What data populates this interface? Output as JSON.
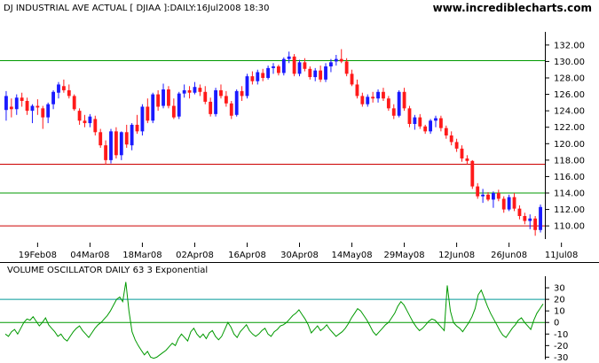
{
  "header": {
    "title": "DJ INDUSTRIAL AVE ACTUAL [ DJIAA ]:DAILY:16Jul2008 18:30",
    "site": "www.incrediblecharts.com"
  },
  "colors": {
    "up_candle": "#1a1aff",
    "down_candle": "#ff1a1a",
    "support_line": "#cc0000",
    "resistance_line": "#009900",
    "oscillator_line": "#009900",
    "oscillator_zero": "#009900",
    "oscillator_band": "#009999"
  },
  "chart_data": [
    {
      "type": "candlestick",
      "title": "DJ INDUSTRIAL AVE ACTUAL [ DJIAA ]:DAILY:16Jul2008 18:30",
      "ylim": [
        108.4,
        133.6
      ],
      "yticks": [
        "132.00",
        "130.00",
        "128.00",
        "126.00",
        "124.00",
        "122.00",
        "120.00",
        "118.00",
        "116.00",
        "114.00",
        "112.00",
        "110.00"
      ],
      "xticks": [
        "19Feb08",
        "04Mar08",
        "18Mar08",
        "02Apr08",
        "16Apr08",
        "30Apr08",
        "14May08",
        "29May08",
        "12Jun08",
        "26Jun08",
        "11Jul08"
      ],
      "xtick_index": [
        6,
        16,
        26,
        36,
        46,
        56,
        66,
        76,
        86,
        96,
        106
      ],
      "reference_lines": [
        {
          "value": 130.1,
          "color": "green"
        },
        {
          "value": 117.5,
          "color": "red"
        },
        {
          "value": 114.0,
          "color": "green"
        },
        {
          "value": 110.0,
          "color": "red"
        }
      ],
      "candles": [
        [
          124.1,
          126.4,
          122.8,
          125.8
        ],
        [
          124.5,
          125.5,
          123.2,
          124.2
        ],
        [
          124.2,
          126.0,
          123.5,
          125.6
        ],
        [
          125.6,
          126.2,
          124.5,
          125.2
        ],
        [
          125.2,
          125.6,
          123.5,
          124.0
        ],
        [
          124.0,
          124.8,
          122.5,
          124.6
        ],
        [
          124.6,
          125.4,
          123.5,
          124.4
        ],
        [
          124.3,
          124.6,
          121.8,
          123.2
        ],
        [
          123.2,
          125.0,
          122.5,
          124.8
        ],
        [
          124.8,
          126.5,
          124.2,
          126.3
        ],
        [
          126.2,
          127.5,
          125.5,
          127.2
        ],
        [
          127.0,
          127.8,
          126.2,
          126.5
        ],
        [
          126.5,
          127.2,
          125.5,
          125.8
        ],
        [
          125.8,
          126.0,
          124.0,
          124.2
        ],
        [
          124.0,
          124.3,
          122.3,
          122.8
        ],
        [
          122.8,
          123.5,
          122.0,
          122.5
        ],
        [
          122.5,
          123.6,
          122.0,
          123.3
        ],
        [
          123.0,
          123.4,
          121.0,
          121.4
        ],
        [
          121.4,
          121.8,
          119.5,
          119.8
        ],
        [
          119.8,
          120.4,
          117.5,
          118.0
        ],
        [
          118.0,
          121.8,
          117.6,
          121.5
        ],
        [
          121.5,
          122.0,
          118.2,
          118.6
        ],
        [
          118.6,
          121.5,
          118.0,
          121.4
        ],
        [
          121.4,
          122.3,
          119.5,
          119.9
        ],
        [
          119.8,
          122.5,
          119.2,
          122.3
        ],
        [
          122.3,
          123.5,
          121.2,
          121.5
        ],
        [
          121.5,
          124.8,
          121.0,
          124.5
        ],
        [
          124.5,
          125.5,
          122.5,
          122.8
        ],
        [
          122.8,
          126.2,
          122.5,
          126.0
        ],
        [
          126.0,
          126.5,
          124.0,
          124.5
        ],
        [
          124.6,
          127.3,
          124.3,
          126.6
        ],
        [
          126.6,
          127.0,
          124.3,
          124.6
        ],
        [
          124.6,
          125.5,
          123.0,
          123.2
        ],
        [
          123.3,
          126.3,
          123.0,
          126.1
        ],
        [
          126.1,
          127.2,
          125.6,
          126.5
        ],
        [
          126.5,
          127.0,
          125.5,
          126.2
        ],
        [
          126.2,
          127.5,
          126.0,
          126.9
        ],
        [
          126.8,
          127.2,
          125.8,
          126.3
        ],
        [
          126.3,
          127.0,
          124.8,
          125.1
        ],
        [
          125.1,
          125.6,
          123.3,
          123.6
        ],
        [
          123.6,
          126.8,
          123.3,
          126.5
        ],
        [
          126.5,
          127.2,
          125.5,
          125.8
        ],
        [
          125.8,
          126.4,
          124.5,
          124.9
        ],
        [
          124.9,
          125.2,
          123.0,
          123.4
        ],
        [
          123.5,
          126.6,
          123.3,
          126.4
        ],
        [
          126.4,
          127.0,
          125.2,
          125.8
        ],
        [
          125.8,
          128.5,
          125.5,
          128.2
        ],
        [
          128.2,
          128.8,
          127.2,
          127.6
        ],
        [
          127.6,
          129.0,
          127.2,
          128.7
        ],
        [
          128.6,
          129.1,
          127.6,
          128.0
        ],
        [
          128.0,
          129.5,
          127.8,
          129.2
        ],
        [
          129.2,
          129.8,
          128.5,
          129.4
        ],
        [
          129.4,
          129.6,
          128.3,
          128.6
        ],
        [
          128.6,
          130.5,
          128.3,
          130.3
        ],
        [
          130.3,
          131.2,
          129.8,
          130.6
        ],
        [
          130.6,
          130.9,
          128.2,
          128.5
        ],
        [
          128.5,
          130.2,
          128.2,
          129.9
        ],
        [
          129.9,
          130.4,
          128.8,
          129.1
        ],
        [
          129.1,
          129.4,
          127.8,
          128.1
        ],
        [
          128.1,
          129.2,
          127.6,
          128.9
        ],
        [
          128.9,
          129.5,
          127.5,
          127.8
        ],
        [
          127.8,
          129.8,
          127.5,
          129.4
        ],
        [
          129.4,
          130.3,
          128.7,
          129.9
        ],
        [
          130.0,
          130.8,
          129.5,
          130.3
        ],
        [
          130.3,
          131.5,
          129.8,
          130.0
        ],
        [
          130.0,
          130.4,
          128.2,
          128.5
        ],
        [
          128.5,
          129.0,
          127.0,
          127.2
        ],
        [
          127.2,
          127.8,
          125.5,
          125.8
        ],
        [
          125.8,
          126.2,
          124.5,
          124.8
        ],
        [
          124.8,
          126.0,
          124.5,
          125.7
        ],
        [
          125.7,
          126.3,
          125.0,
          125.5
        ],
        [
          125.5,
          126.6,
          125.0,
          126.3
        ],
        [
          126.3,
          126.8,
          125.2,
          125.5
        ],
        [
          125.5,
          125.8,
          124.0,
          124.3
        ],
        [
          124.3,
          124.8,
          123.0,
          123.4
        ],
        [
          123.4,
          126.5,
          123.2,
          126.3
        ],
        [
          126.3,
          126.8,
          124.0,
          124.3
        ],
        [
          124.3,
          124.6,
          122.0,
          122.4
        ],
        [
          122.4,
          123.5,
          121.7,
          123.2
        ],
        [
          123.2,
          123.6,
          121.8,
          122.1
        ],
        [
          122.1,
          122.3,
          121.2,
          121.5
        ],
        [
          121.5,
          123.0,
          121.2,
          122.8
        ],
        [
          122.8,
          123.4,
          122.0,
          123.1
        ],
        [
          123.1,
          123.4,
          121.5,
          121.9
        ],
        [
          121.9,
          122.2,
          120.6,
          121.0
        ],
        [
          121.0,
          121.5,
          119.8,
          120.2
        ],
        [
          120.2,
          120.6,
          119.0,
          119.4
        ],
        [
          119.4,
          119.8,
          117.8,
          118.2
        ],
        [
          118.2,
          118.6,
          117.5,
          117.9
        ],
        [
          117.9,
          118.0,
          114.5,
          114.8
        ],
        [
          114.8,
          115.2,
          113.3,
          113.6
        ],
        [
          113.6,
          114.5,
          112.8,
          113.8
        ],
        [
          113.8,
          114.1,
          113.0,
          113.2
        ],
        [
          113.2,
          114.2,
          112.2,
          114.0
        ],
        [
          114.0,
          114.4,
          113.0,
          113.3
        ],
        [
          113.3,
          113.6,
          111.6,
          112.0
        ],
        [
          112.0,
          113.8,
          111.8,
          113.5
        ],
        [
          113.5,
          114.0,
          111.8,
          112.1
        ],
        [
          112.1,
          112.5,
          110.8,
          111.2
        ],
        [
          111.2,
          111.6,
          110.2,
          110.6
        ],
        [
          110.6,
          111.4,
          109.6,
          110.9
        ],
        [
          110.9,
          111.2,
          108.8,
          109.5
        ],
        [
          109.5,
          112.6,
          109.2,
          112.3
        ]
      ]
    },
    {
      "type": "line",
      "title": "VOLUME OSCILLATOR DAILY 63 3 Exponential",
      "ylim": [
        -32,
        40
      ],
      "yticks": [
        "30",
        "20",
        "10",
        "0",
        "-10",
        "-20",
        "-30"
      ],
      "reference_lines": [
        {
          "value": 20
        },
        {
          "value": 0
        }
      ],
      "values": [
        -10,
        -12,
        -8,
        -6,
        -10,
        -5,
        0,
        3,
        2,
        5,
        1,
        -3,
        0,
        4,
        -2,
        -5,
        -8,
        -12,
        -10,
        -14,
        -16,
        -12,
        -8,
        -5,
        -3,
        -7,
        -10,
        -13,
        -9,
        -5,
        -2,
        0,
        3,
        6,
        10,
        15,
        20,
        22,
        18,
        35,
        10,
        -8,
        -15,
        -20,
        -24,
        -28,
        -25,
        -30,
        -31,
        -30,
        -28,
        -26,
        -24,
        -21,
        -18,
        -20,
        -14,
        -10,
        -13,
        -16,
        -8,
        -5,
        -10,
        -13,
        -10,
        -14,
        -9,
        -7,
        -12,
        -15,
        -12,
        -6,
        0,
        -4,
        -10,
        -13,
        -8,
        -5,
        -2,
        -7,
        -10,
        -12,
        -10,
        -7,
        -5,
        -10,
        -12,
        -8,
        -6,
        -3,
        -2,
        0,
        3,
        6,
        8,
        11,
        7,
        3,
        -2,
        -9,
        -6,
        -3,
        -7,
        -5,
        -2,
        -6,
        -9,
        -12,
        -10,
        -8,
        -5,
        -1,
        4,
        8,
        12,
        10,
        6,
        2,
        -3,
        -8,
        -11,
        -8,
        -5,
        -2,
        0,
        4,
        8,
        14,
        18,
        15,
        10,
        5,
        0,
        -4,
        -7,
        -5,
        -2,
        1,
        3,
        2,
        -1,
        -4,
        -7,
        32,
        10,
        0,
        -3,
        -5,
        -8,
        -4,
        0,
        5,
        12,
        24,
        28,
        21,
        14,
        8,
        3,
        -2,
        -7,
        -11,
        -13,
        -9,
        -5,
        -2,
        2,
        4,
        0,
        -3,
        -6,
        2,
        8,
        12,
        16
      ]
    }
  ]
}
